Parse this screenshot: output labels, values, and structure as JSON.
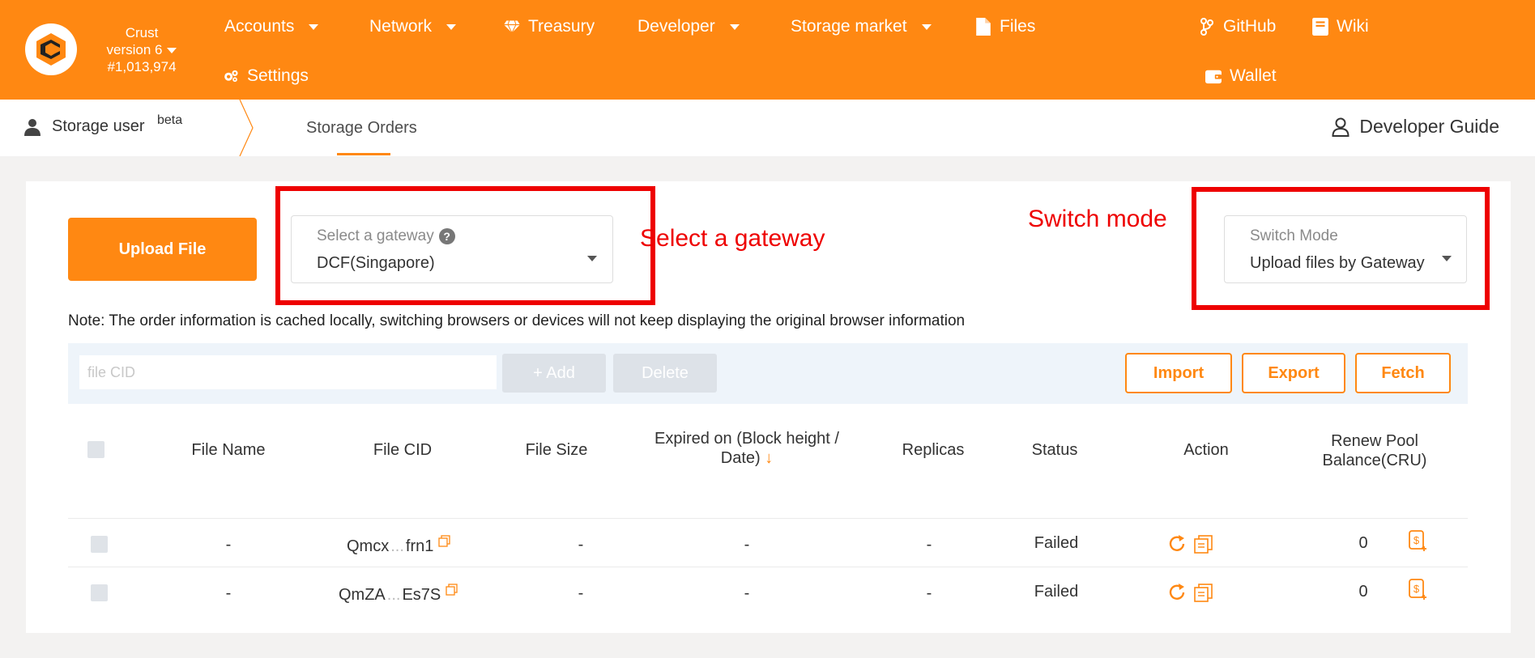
{
  "chain": {
    "name": "Crust",
    "version": "version 6",
    "block": "#1,013,974"
  },
  "nav": {
    "accounts": "Accounts",
    "network": "Network",
    "treasury": "Treasury",
    "developer": "Developer",
    "storage_market": "Storage market",
    "files": "Files",
    "github": "GitHub",
    "wiki": "Wiki",
    "settings": "Settings",
    "wallet": "Wallet"
  },
  "subnav": {
    "user_label": "Storage user",
    "beta": "beta",
    "tab": "Storage Orders",
    "guide": "Developer Guide"
  },
  "upload_button": "Upload File",
  "gateway": {
    "label": "Select a gateway",
    "value": "DCF(Singapore)"
  },
  "mode": {
    "label": "Switch Mode",
    "value": "Upload files by Gateway"
  },
  "annotations": {
    "gateway": "Select a gateway",
    "mode": "Switch mode"
  },
  "note": "Note: The order information is cached locally, switching browsers or devices will not keep displaying the original browser information",
  "toolbar": {
    "cid_placeholder": "file CID",
    "add": "+ Add",
    "delete": "Delete",
    "import": "Import",
    "export": "Export",
    "fetch": "Fetch"
  },
  "table": {
    "headers": {
      "file_name": "File Name",
      "file_cid": "File CID",
      "file_size": "File Size",
      "expired_1": "Expired on (Block height /",
      "expired_2": "Date)",
      "replicas": "Replicas",
      "status": "Status",
      "action": "Action",
      "renew_1": "Renew Pool",
      "renew_2": "Balance(CRU)"
    },
    "rows": [
      {
        "name": "-",
        "cid_start": "Qmcx",
        "cid_dots": "...",
        "cid_end": "frn1",
        "size": "-",
        "expired": "-",
        "replicas": "-",
        "status": "Failed",
        "balance": "0"
      },
      {
        "name": "-",
        "cid_start": "QmZA",
        "cid_dots": "...",
        "cid_end": "Es7S",
        "size": "-",
        "expired": "-",
        "replicas": "-",
        "status": "Failed",
        "balance": "0"
      }
    ]
  },
  "colors": {
    "brand": "#ff8812",
    "annotation": "#ee0000"
  }
}
